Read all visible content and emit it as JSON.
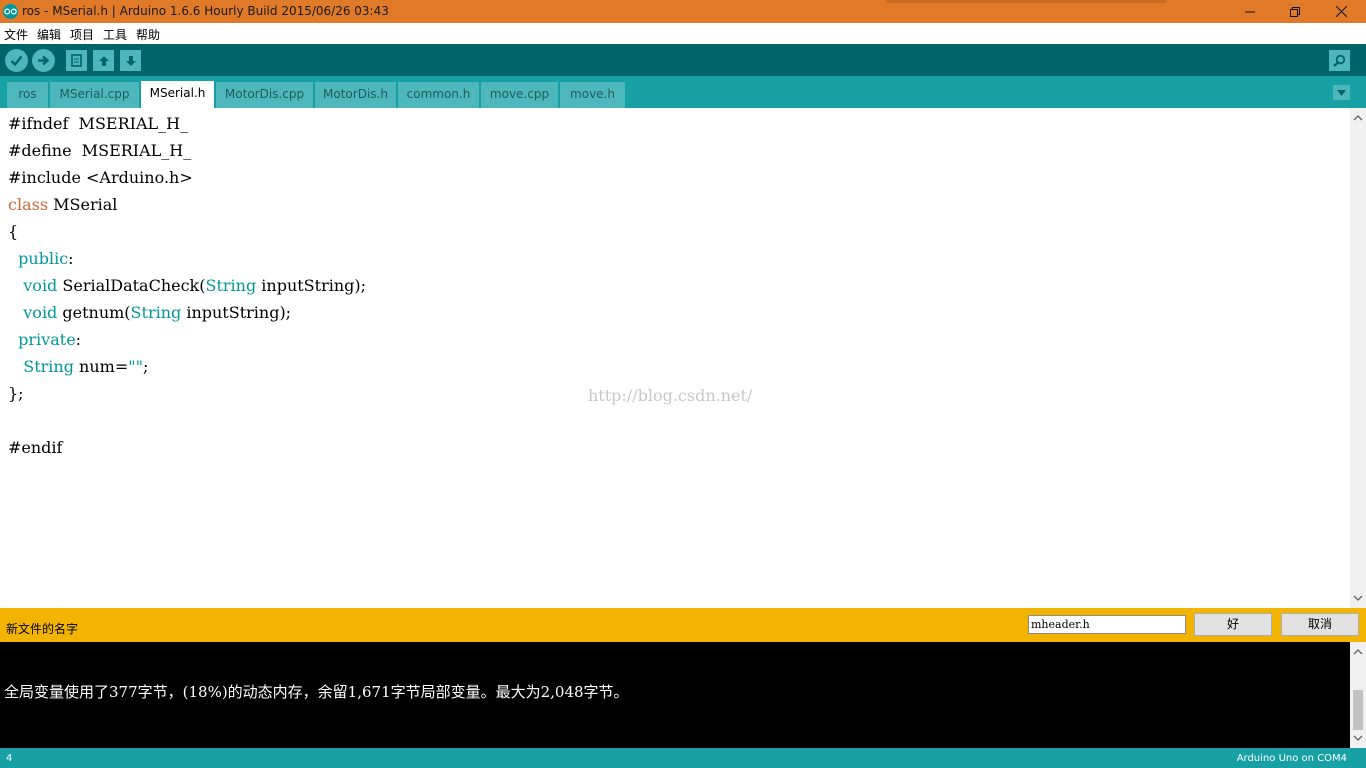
{
  "window": {
    "title": "ros - MSerial.h | Arduino 1.6.6 Hourly Build 2015/06/26 03:43"
  },
  "menu": [
    "文件",
    "编辑",
    "项目",
    "工具",
    "帮助"
  ],
  "toolbar": {
    "buttons": [
      "verify-icon",
      "upload-icon",
      "new-icon",
      "open-icon",
      "save-icon"
    ],
    "right": "serial-monitor-icon"
  },
  "tabs": [
    {
      "label": "ros",
      "active": false
    },
    {
      "label": "MSerial.cpp",
      "active": false
    },
    {
      "label": "MSerial.h",
      "active": true
    },
    {
      "label": "MotorDis.cpp",
      "active": false
    },
    {
      "label": "MotorDis.h",
      "active": false
    },
    {
      "label": "common.h",
      "active": false
    },
    {
      "label": "move.cpp",
      "active": false
    },
    {
      "label": "move.h",
      "active": false
    }
  ],
  "editor": {
    "lines": [
      [
        {
          "t": "#ifndef  MSERIAL_H_"
        }
      ],
      [
        {
          "t": "#define  MSERIAL_H_"
        }
      ],
      [
        {
          "t": "#include <Arduino.h>"
        }
      ],
      [
        {
          "t": "class",
          "c": "kw2"
        },
        {
          "t": " MSerial"
        }
      ],
      [
        {
          "t": "{"
        }
      ],
      [
        {
          "t": "  "
        },
        {
          "t": "public",
          "c": "kw"
        },
        {
          "t": ":"
        }
      ],
      [
        {
          "t": "   "
        },
        {
          "t": "void",
          "c": "kw"
        },
        {
          "t": " SerialDataCheck("
        },
        {
          "t": "String",
          "c": "kw"
        },
        {
          "t": " inputString);"
        }
      ],
      [
        {
          "t": "   "
        },
        {
          "t": "void",
          "c": "kw"
        },
        {
          "t": " getnum("
        },
        {
          "t": "String",
          "c": "kw"
        },
        {
          "t": " inputString);"
        }
      ],
      [
        {
          "t": "  "
        },
        {
          "t": "private",
          "c": "kw"
        },
        {
          "t": ":"
        }
      ],
      [
        {
          "t": "   "
        },
        {
          "t": "String",
          "c": "kw"
        },
        {
          "t": " num="
        },
        {
          "t": "\"\"",
          "c": "kw"
        },
        {
          "t": ";"
        }
      ],
      [
        {
          "t": "};"
        }
      ],
      [
        {
          "t": ""
        }
      ],
      [
        {
          "t": "#endif"
        }
      ]
    ],
    "watermark": "http://blog.csdn.net/"
  },
  "rename": {
    "label": "新文件的名字",
    "value": "mheader.h",
    "ok": "好",
    "cancel": "取消"
  },
  "console": {
    "message": "全局变量使用了377字节，(18%)的动态内存，余留1,671字节局部变量。最大为2,048字节。"
  },
  "status": {
    "line": "4",
    "board": "Arduino Uno on COM4"
  },
  "colors": {
    "titlebar": "#e07a28",
    "toolbar": "#006468",
    "tabbar": "#17a1a5",
    "rename_bar": "#f2b400",
    "keyword": "#00979c",
    "class_keyword": "#cc6633"
  }
}
